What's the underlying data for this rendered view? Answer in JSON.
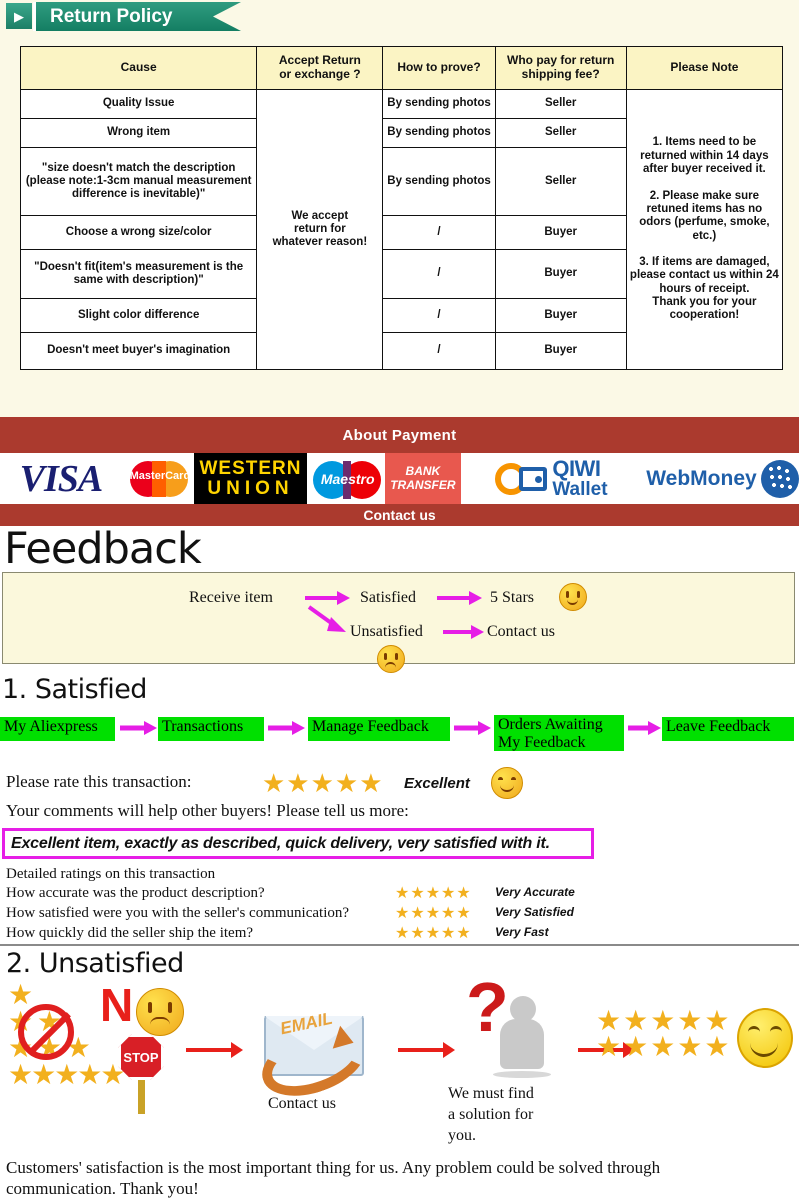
{
  "return_policy": {
    "badge_icon": "arrow-right-icon",
    "title": "Return Policy",
    "table": {
      "headers": [
        "Cause",
        "Accept Return or exchange ?",
        "How to prove?",
        "Who pay for return shipping fee?",
        "Please Note"
      ],
      "header_accept_line1": "Accept Return",
      "header_accept_line2": "or exchange ?",
      "header_who_line1": "Who pay for return",
      "header_who_line2": "shipping fee?",
      "accept_merged_text": "We accept\nreturn for\nwhatever reason!",
      "note_text": "1. Items need to be returned within 14 days after buyer received it.\n\n2. Please make sure retuned items has no odors (perfume, smoke, etc.)\n\n3. If items are damaged, please contact us within 24 hours of receipt.\nThank you for your cooperation!",
      "rows": [
        {
          "cause": "Quality Issue",
          "prove": "By sending photos",
          "who": "Seller"
        },
        {
          "cause": "Wrong item",
          "prove": "By sending photos",
          "who": "Seller"
        },
        {
          "cause": "\"size doesn't match the description (please note:1-3cm manual measurement difference is inevitable)\"",
          "prove": "By sending photos",
          "who": "Seller"
        },
        {
          "cause": "Choose a wrong size/color",
          "prove": "/",
          "who": "Buyer"
        },
        {
          "cause": "\"Doesn't fit(item's measurement is the same with description)\"",
          "prove": "/",
          "who": "Buyer"
        },
        {
          "cause": "Slight color difference",
          "prove": "/",
          "who": "Buyer"
        },
        {
          "cause": "Doesn't meet buyer's imagination",
          "prove": "/",
          "who": "Buyer"
        }
      ]
    }
  },
  "payment": {
    "title": "About Payment",
    "contact_title": "Contact us",
    "band_color": "#ab3a2e",
    "logos": [
      {
        "name": "visa-logo",
        "label": "VISA"
      },
      {
        "name": "mastercard-logo",
        "label": "MasterCard"
      },
      {
        "name": "western-union-logo",
        "label_line1": "WESTERN",
        "label_line2": "UNION"
      },
      {
        "name": "maestro-logo",
        "label": "Maestro"
      },
      {
        "name": "bank-transfer-logo",
        "label_line1": "BANK",
        "label_line2": "TRANSFER"
      },
      {
        "name": "qiwi-wallet-logo",
        "label_line1": "QIWI",
        "label_line2": "Wallet"
      },
      {
        "name": "webmoney-logo",
        "label": "WebMoney"
      }
    ]
  },
  "feedback": {
    "title": "Feedback",
    "flow": {
      "start": "Receive item",
      "satisfied": "Satisfied",
      "five_stars": "5 Stars",
      "unsatisfied": "Unsatisfied",
      "contact_us": "Contact us"
    }
  },
  "satisfied": {
    "heading": "1. Satisfied",
    "steps": [
      "My Aliexpress",
      "Transactions",
      "Manage Feedback",
      "Orders Awaiting My Feedback",
      "Leave Feedback"
    ],
    "step4_line1": "Orders Awaiting",
    "step4_line2": "My Feedback",
    "rate_label": "Please rate this transaction:",
    "rate_stars": "★★★★★",
    "rate_word": "Excellent",
    "comments_prompt": "Your comments will help other buyers! Please tell us more:",
    "comment_text": "Excellent item, exactly as described, quick delivery, very satisfied with it.",
    "detailed_title": "Detailed ratings on this transaction",
    "detailed_rows": [
      {
        "question": "How accurate was the product description?",
        "stars": "★★★★★",
        "rating": "Very Accurate"
      },
      {
        "question": "How satisfied were you with the seller's communication?",
        "stars": "★★★★★",
        "rating": "Very Satisfied"
      },
      {
        "question": "How quickly did the seller ship the item?",
        "stars": "★★★★★",
        "rating": "Very Fast"
      }
    ]
  },
  "unsatisfied": {
    "heading": "2. Unsatisfied",
    "no_label": "N",
    "stop_label": "STOP",
    "email_label": "EMAIL",
    "contact_caption": "Contact us",
    "solution_caption": "We must find\na solution for\nyou.",
    "solution_line1": "We must find",
    "solution_line2": "a solution for",
    "solution_line3": "you.",
    "question_mark": "?",
    "stars_top": "★★★★★",
    "stars_bottom": "★★★★★",
    "footer_line1": "Customers' satisfaction is the most important thing for us. Any problem could be solved through",
    "footer_line2": "communication. Thank you!"
  }
}
